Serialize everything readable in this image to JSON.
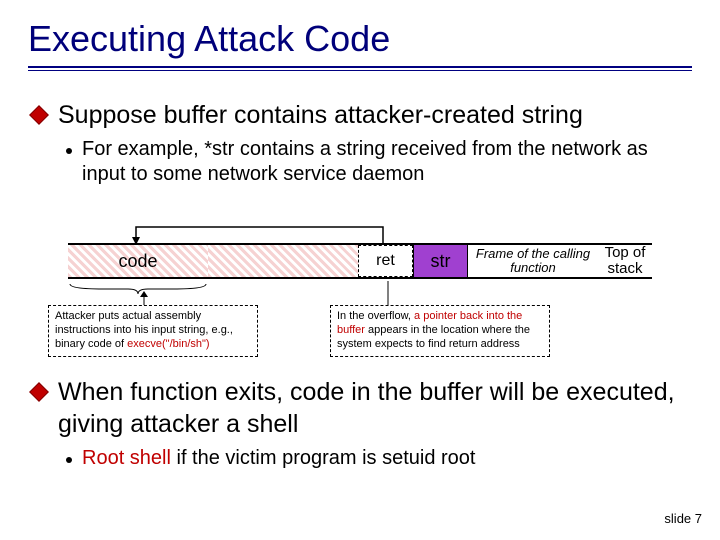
{
  "title": "Executing Attack Code",
  "bullets": {
    "b1": "Suppose buffer contains attacker-created string",
    "b1_sub": "For example, *str contains a string received from the network as input to some network service daemon",
    "b2": "When function exits, code in the buffer will be executed, giving attacker a shell",
    "b2_sub_prefix": "Root shell",
    "b2_sub_rest": " if the victim program is setuid root"
  },
  "diagram": {
    "code_label": "code",
    "ret_label": "ret",
    "str_label": "str",
    "frame_label": "Frame of the calling function",
    "top_label": "Top of stack",
    "callout_left_1": "Attacker puts actual assembly instructions into his input string, e.g., binary code of ",
    "callout_left_2": "execve(\"/bin/sh\")",
    "callout_right_1": "In the overflow, ",
    "callout_right_2": "a pointer back into the buffer",
    "callout_right_3": " appears in the location where the system expects to find return address"
  },
  "footer": "slide 7"
}
